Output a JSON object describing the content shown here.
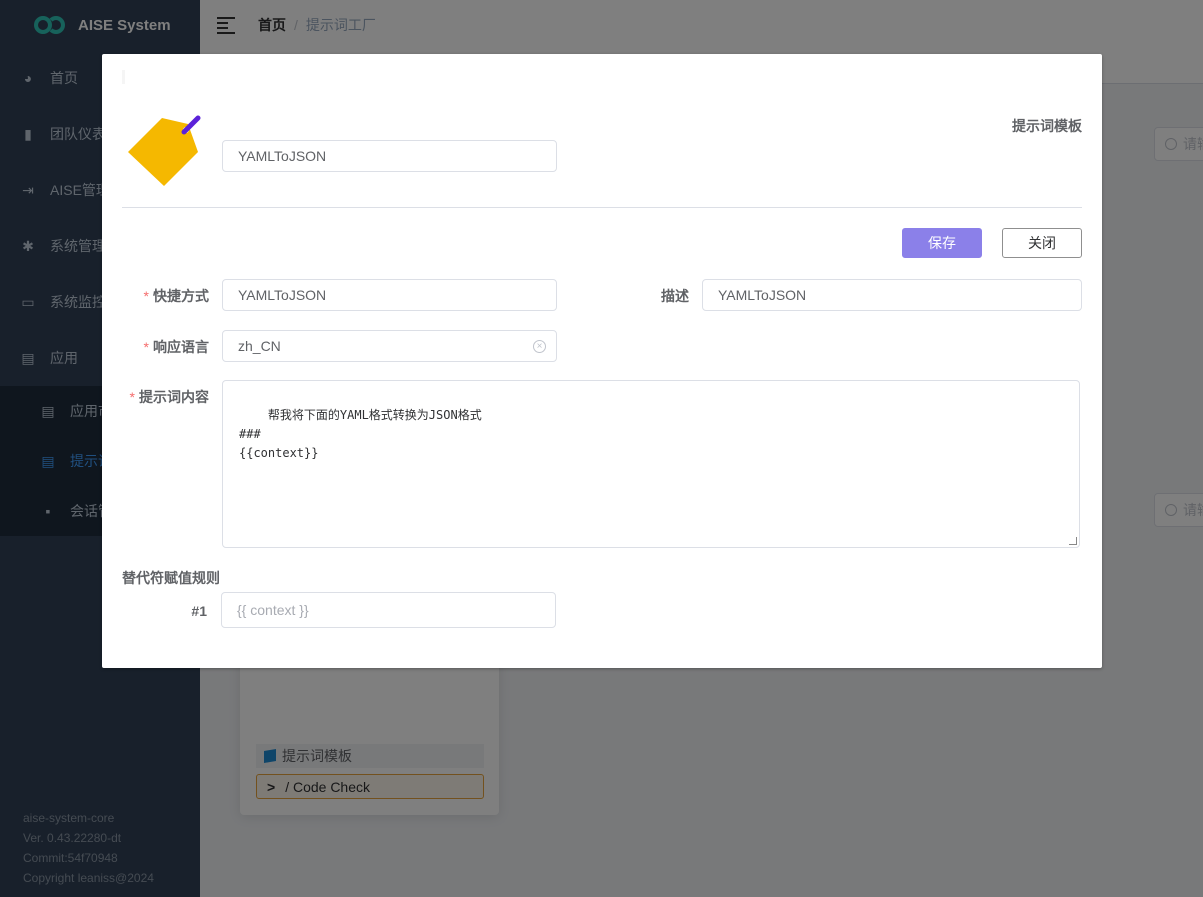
{
  "app": {
    "title": "AISE System"
  },
  "sidebar": {
    "items": [
      {
        "label": "首页",
        "icon": "dashboard-icon"
      },
      {
        "label": "团队仪表",
        "icon": "bar-chart-icon"
      },
      {
        "label": "AISE管理",
        "icon": "manage-icon"
      },
      {
        "label": "系统管理",
        "icon": "gear-icon"
      },
      {
        "label": "系统监控",
        "icon": "monitor-icon"
      },
      {
        "label": "应用",
        "icon": "app-doc-icon"
      }
    ],
    "subitems": [
      {
        "label": "应用市",
        "icon": "doc-icon"
      },
      {
        "label": "提示词",
        "icon": "doc-icon"
      },
      {
        "label": "会话管",
        "icon": "chat-icon"
      }
    ],
    "footer": {
      "line1": "aise-system-core",
      "line2": "Ver. 0.43.22280-dt",
      "line3": "Commit:54f70948",
      "line4": "Copyright leaniss@2024"
    }
  },
  "navbar": {
    "breadcrumb_home": "首页",
    "breadcrumb_sep": "/",
    "breadcrumb_current": "提示词工厂"
  },
  "background": {
    "search_placeholder": "请输",
    "card_tag": "提示词模板",
    "card_command_prefix": ">",
    "card_command": "/ Code Check"
  },
  "dialog": {
    "name_value": "YAMLToJSON",
    "type_label": "提示词模板",
    "save_label": "保存",
    "close_label": "关闭",
    "shortcut": {
      "label": "快捷方式",
      "value": "YAMLToJSON"
    },
    "description": {
      "label": "描述",
      "value": "YAMLToJSON"
    },
    "language": {
      "label": "响应语言",
      "value": "zh_CN"
    },
    "prompt": {
      "label": "提示词内容",
      "value": "帮我将下面的YAML格式转换为JSON格式\n###\n{{context}}"
    },
    "rules_title": "替代符赋值规则",
    "rules": [
      {
        "label": "#1",
        "placeholder": "{{ context }}"
      }
    ],
    "required_mark": "*"
  },
  "colors": {
    "sidebar_bg": "#304156",
    "active_menu": "#409eff",
    "save_button": "#8b80e9",
    "required": "#f56c6c",
    "tag_icon_fill": "#f5b800",
    "tag_icon_string": "#5b21d9"
  }
}
